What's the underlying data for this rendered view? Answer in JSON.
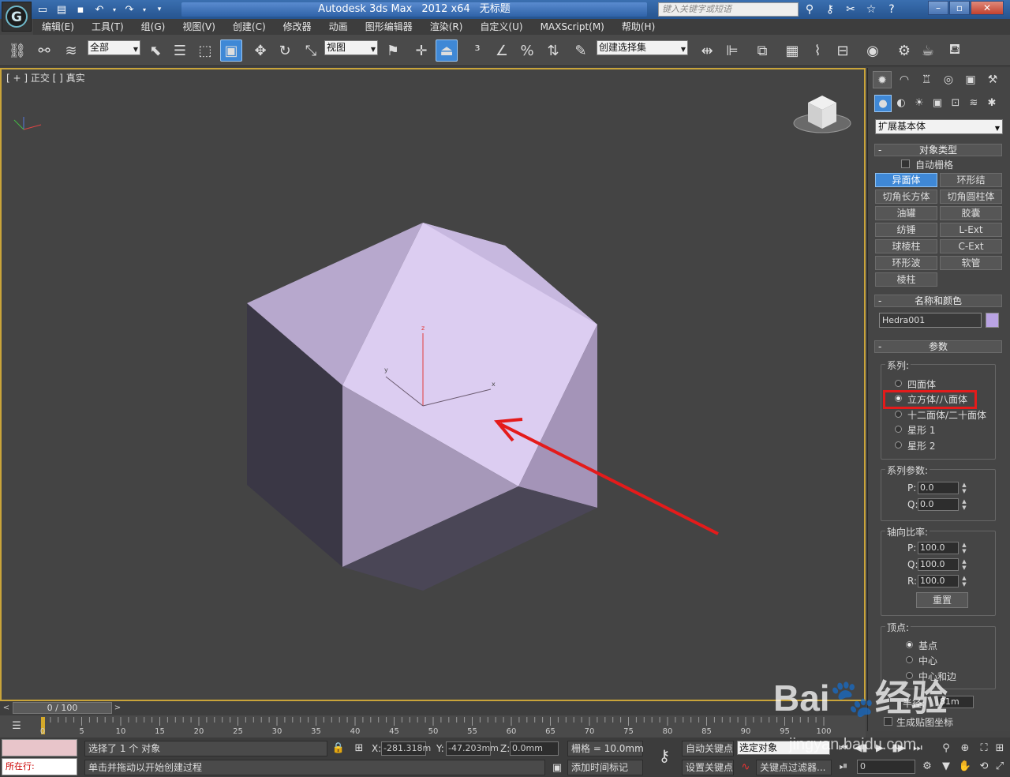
{
  "title": {
    "app": "Autodesk 3ds Max",
    "version": "2012 x64",
    "doc": "无标题",
    "search_placeholder": "键入关键字或短语"
  },
  "menu": [
    "编辑(E)",
    "工具(T)",
    "组(G)",
    "视图(V)",
    "创建(C)",
    "修改器",
    "动画",
    "图形编辑器",
    "渲染(R)",
    "自定义(U)",
    "MAXScript(M)",
    "帮助(H)"
  ],
  "toolbar": {
    "filter_select": "全部",
    "ref_coord": "视图",
    "named_sel": "创建选择集"
  },
  "viewport": {
    "label": "[ + ] 正交 [ ] 真实",
    "axes": {
      "x": "x",
      "y": "y",
      "z": "z"
    }
  },
  "panel": {
    "category": "扩展基本体",
    "rollouts": {
      "object_type": "对象类型",
      "autogrid": "自动栅格",
      "name_color": "名称和颜色",
      "params": "参数"
    },
    "object_buttons": [
      "异面体",
      "环形结",
      "切角长方体",
      "切角圆柱体",
      "油罐",
      "胶囊",
      "纺锤",
      "L-Ext",
      "球棱柱",
      "C-Ext",
      "环形波",
      "软管",
      "棱柱"
    ],
    "object_name": "Hedra001",
    "object_color": "#b9a3e3",
    "family_label": "系列:",
    "family": [
      "四面体",
      "立方体/八面体",
      "十二面体/二十面体",
      "星形 1",
      "星形 2"
    ],
    "family_selected": 1,
    "family_params_label": "系列参数:",
    "p_label": "P:",
    "q_label": "Q:",
    "r_label": "R:",
    "p": "0.0",
    "q": "0.0",
    "axis_label": "轴向比率:",
    "axis_p": "100.0",
    "axis_q": "100.0",
    "axis_r": "100.0",
    "reset": "重置",
    "vertex_label": "顶点:",
    "vertex": [
      "基点",
      "中心",
      "中心和边"
    ],
    "radius_label": "半径:",
    "radius": "81m",
    "gen_uv": "生成贴图坐标"
  },
  "timeline": {
    "position": "0 / 100",
    "ticks": [
      "0",
      "5",
      "10",
      "15",
      "20",
      "25",
      "30",
      "35",
      "40",
      "45",
      "50",
      "55",
      "60",
      "65",
      "70",
      "75",
      "80",
      "85",
      "90",
      "95",
      "100"
    ]
  },
  "status": {
    "running": "所在行:",
    "selected": "选择了 1 个 对象",
    "prompt": "单击并拖动以开始创建过程",
    "x_label": "X:",
    "y_label": "Y:",
    "z_label": "Z:",
    "x": "-281.318m",
    "y": "-47.203mm",
    "z": "0.0mm",
    "grid": "栅格 = 10.0mm",
    "add_time_tag": "添加时间标记",
    "auto_key": "自动关键点",
    "set_key": "设置关键点",
    "sel_dropdown": "选定对象",
    "key_filter": "关键点过滤器...",
    "frame": "0"
  },
  "watermark": "Bai🐾经验",
  "watermark_sub": "jingyan.baidu.com",
  "colors": {
    "accent": "#3f88d6",
    "highlight": "#e41b1b",
    "viewport_border": "#c9a43a"
  }
}
